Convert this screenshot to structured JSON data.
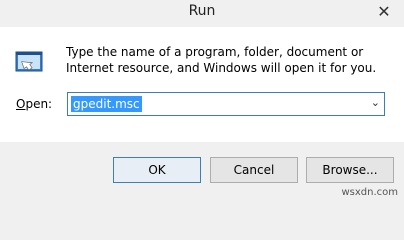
{
  "window": {
    "title": "Run",
    "close_glyph": "✕"
  },
  "content": {
    "description": "Type the name of a program, folder, document or Internet resource, and Windows will open it for you.",
    "open_label_underlined": "O",
    "open_label_rest": "pen:",
    "input_value": "gpedit.msc"
  },
  "buttons": {
    "ok": "OK",
    "cancel": "Cancel",
    "browse": "Browse..."
  },
  "watermark": "wsxdn.com",
  "icons": {
    "run": "run-dialog-icon",
    "dropdown": "chevron-down-icon"
  }
}
